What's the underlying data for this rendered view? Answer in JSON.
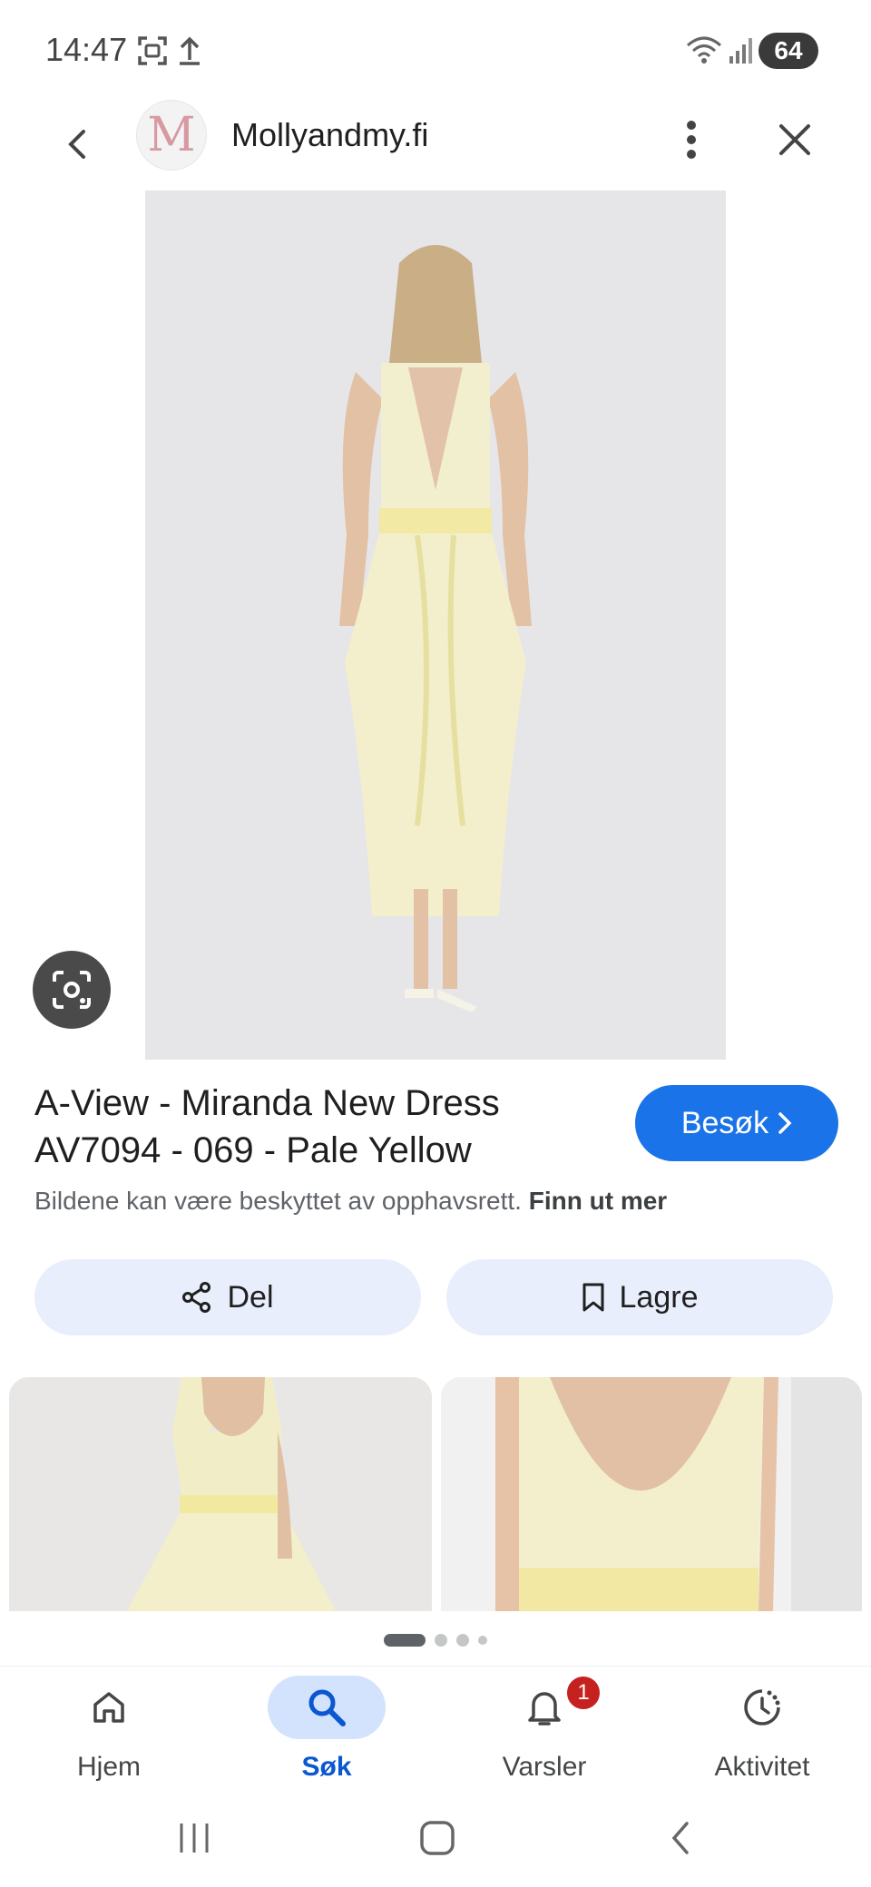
{
  "status_bar": {
    "time": "14:47",
    "battery": "64"
  },
  "header": {
    "logo_letter": "M",
    "site_name": "Mollyandmy.fi"
  },
  "product": {
    "title": "A-View - Miranda New Dress AV7094 - 069 - Pale Yellow",
    "visit_label": "Besøk",
    "copyright_text": "Bildene kan være beskyttet av opphavsrett.",
    "copyright_link": "Finn ut mer"
  },
  "actions": {
    "share_label": "Del",
    "save_label": "Lagre"
  },
  "bottom_nav": {
    "items": [
      {
        "label": "Hjem",
        "icon": "home-icon"
      },
      {
        "label": "Søk",
        "icon": "search-icon"
      },
      {
        "label": "Varsler",
        "icon": "bell-icon",
        "badge": "1"
      },
      {
        "label": "Aktivitet",
        "icon": "activity-icon"
      }
    ]
  },
  "colors": {
    "accent": "#1a73e8",
    "nav_active": "#0b57d0",
    "badge": "#c5221f",
    "dress": "#f4efc4"
  }
}
